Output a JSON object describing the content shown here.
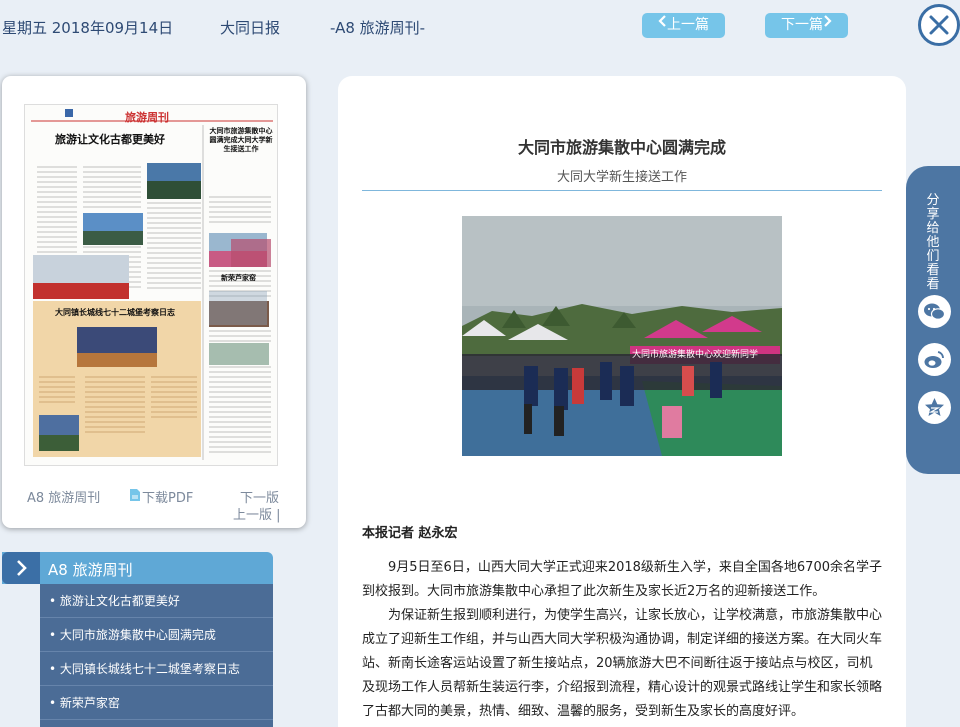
{
  "header": {
    "date": "星期五 2018年09月14日",
    "paper_name": "大同日报",
    "edition": "-A8 旅游周刊-",
    "prev_label": "上一篇",
    "next_label": "下一篇"
  },
  "thumbnail": {
    "edition_label": "A8 旅游周刊",
    "pdf_label": "下载PDF",
    "next_page": "下一版",
    "prev_page": "上一版 |",
    "paper": {
      "masthead": "旅游周刊",
      "main_title": "旅游让文化古都更美好",
      "side_title": "大同市旅游集散中心圆满完成大同大学新生接送工作",
      "section_title": "大同镇长城线七十二城堡考察日志",
      "small_title": "新荣芦家窑"
    }
  },
  "menu": {
    "title": "A8 旅游周刊",
    "items": [
      "旅游让文化古都更美好",
      "大同市旅游集散中心圆满完成",
      "大同镇长城线七十二城堡考察日志",
      "新荣芦家窑"
    ]
  },
  "article": {
    "title": "大同市旅游集散中心圆满完成",
    "subtitle": "大同大学新生接送工作",
    "photo_banner": "大同市旅游集散中心欢迎新同学",
    "byline": "本报记者 赵永宏",
    "paragraphs": [
      "9月5日至6日，山西大同大学正式迎来2018级新生入学，来自全国各地6700余名学子到校报到。大同市旅游集散中心承担了此次新生及家长近2万名的迎新接送工作。",
      "为保证新生报到顺利进行，为使学生高兴，让家长放心，让学校满意，市旅游集散中心成立了迎新生工作组，并与山西大同大学积极沟通协调，制定详细的接送方案。在大同火车站、新南长途客运站设置了新生接站点，20辆旅游大巴不间断往返于接站点与校区，司机及现场工作人员帮新生装运行李，介绍报到流程，精心设计的观景式路线让学生和家长领略了古都大同的美景，热情、细致、温馨的服务，受到新生及家长的高度好评。"
    ]
  },
  "share": {
    "label": "分享给他们看看",
    "buttons": [
      "wechat-icon",
      "weibo-icon",
      "favorite-icon"
    ]
  },
  "colors": {
    "background": "#e9eff6",
    "nav_button": "#76c5e9",
    "menu_bg": "#4b6c96",
    "share_bg": "#4d76a3",
    "close_ring": "#3a6ea5"
  }
}
